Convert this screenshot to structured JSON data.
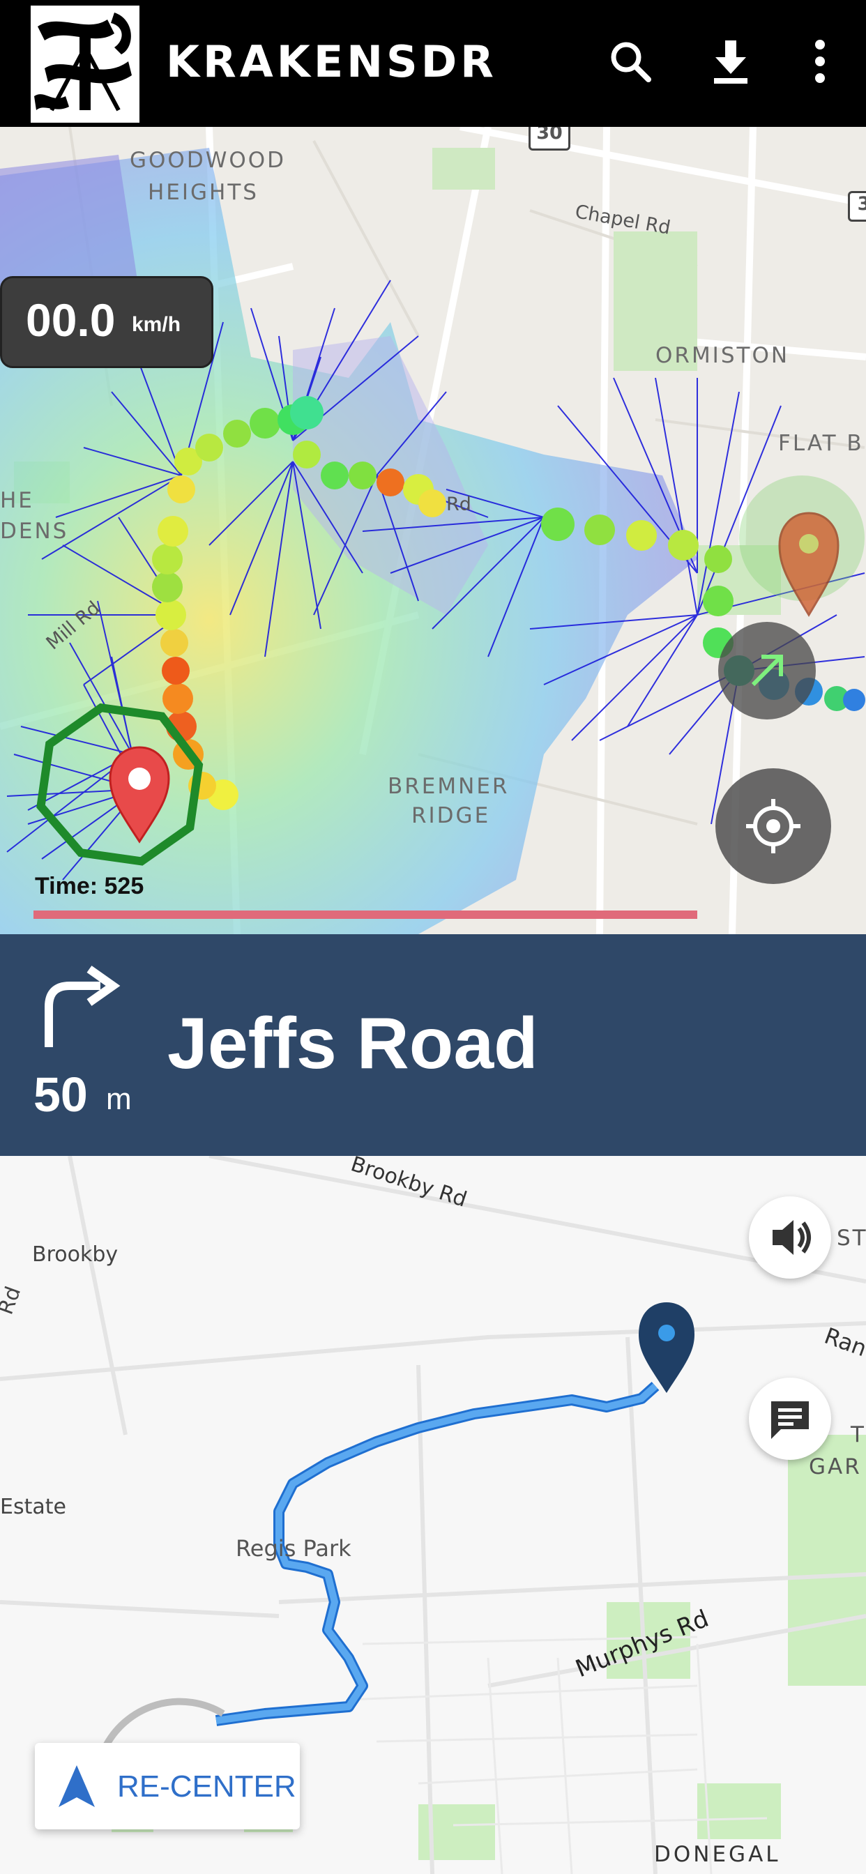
{
  "app": {
    "title": "KRAKENSDR"
  },
  "appbar": {
    "search_icon": "search-icon",
    "download_icon": "download-icon",
    "menu_icon": "more-vert-icon"
  },
  "map_top": {
    "labels": {
      "goodwood_1": "GOODWOOD",
      "goodwood_2": "HEIGHTS",
      "ormiston": "ORMISTON",
      "flat_bush": "FLAT B",
      "gardens_1": "HE",
      "gardens_2": "DENS",
      "bremner_1": "BREMNER",
      "bremner_2": "RIDGE"
    },
    "roads": {
      "chapel": "Chapel Rd",
      "mill": "Mill Rd",
      "rd": "Rd"
    },
    "shields": {
      "shield_30": "30",
      "shield_3": "3"
    },
    "speed": {
      "value": "00.0",
      "unit": "km/h"
    },
    "time_label": "Time: 525",
    "locate_icon": "locate-icon",
    "direction_icon": "direction-arrow-icon"
  },
  "navigation": {
    "turn_icon": "turn-right-icon",
    "distance_value": "50",
    "distance_unit": "m",
    "street": "Jeffs Road"
  },
  "map_bottom": {
    "roads": {
      "brookby_rd": "Brookby Rd",
      "murphys_rd": "Murphys Rd",
      "ran": "Ran",
      "rd_left": "Rd"
    },
    "labels": {
      "brookby": "Brookby",
      "estate": "Estate",
      "regis_park": "Regis Park",
      "donegal": "DONEGAL",
      "sto": "STO",
      "t": "T",
      "gar": "GAR"
    },
    "sound_icon": "volume-icon",
    "message_icon": "message-icon",
    "recenter_label": "RE-CENTER"
  },
  "colors": {
    "appbar": "#000000",
    "nav_banner": "#2f4868",
    "route": "#4a9ae6",
    "accent": "#2f6fc9"
  }
}
